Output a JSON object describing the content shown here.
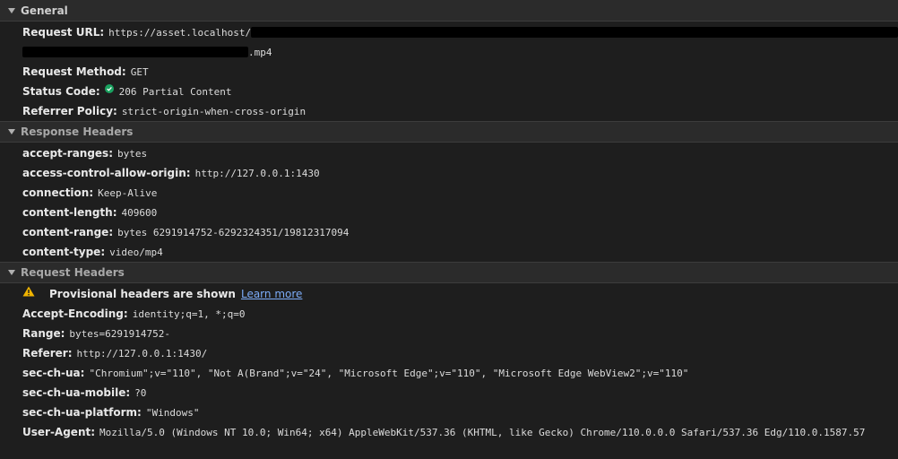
{
  "general": {
    "title": "General",
    "request_url_label": "Request URL:",
    "request_url_value": "https://asset.localhost/",
    "request_url_suffix": ".mp4",
    "request_method_label": "Request Method:",
    "request_method_value": "GET",
    "status_code_label": "Status Code:",
    "status_code_value": "206 Partial Content",
    "referrer_policy_label": "Referrer Policy:",
    "referrer_policy_value": "strict-origin-when-cross-origin"
  },
  "response_headers": {
    "title": "Response Headers",
    "items": [
      {
        "key": "accept-ranges:",
        "value": "bytes"
      },
      {
        "key": "access-control-allow-origin:",
        "value": "http://127.0.0.1:1430"
      },
      {
        "key": "connection:",
        "value": "Keep-Alive"
      },
      {
        "key": "content-length:",
        "value": "409600"
      },
      {
        "key": "content-range:",
        "value": "bytes 6291914752-6292324351/19812317094"
      },
      {
        "key": "content-type:",
        "value": "video/mp4"
      }
    ]
  },
  "request_headers": {
    "title": "Request Headers",
    "warning_text": "Provisional headers are shown",
    "learn_more": "Learn more",
    "items": [
      {
        "key": "Accept-Encoding:",
        "value": "identity;q=1, *;q=0"
      },
      {
        "key": "Range:",
        "value": "bytes=6291914752-"
      },
      {
        "key": "Referer:",
        "value": "http://127.0.0.1:1430/"
      },
      {
        "key": "sec-ch-ua:",
        "value": "\"Chromium\";v=\"110\", \"Not A(Brand\";v=\"24\", \"Microsoft Edge\";v=\"110\", \"Microsoft Edge WebView2\";v=\"110\""
      },
      {
        "key": "sec-ch-ua-mobile:",
        "value": "?0"
      },
      {
        "key": "sec-ch-ua-platform:",
        "value": "\"Windows\""
      },
      {
        "key": "User-Agent:",
        "value": "Mozilla/5.0 (Windows NT 10.0; Win64; x64) AppleWebKit/537.36 (KHTML, like Gecko) Chrome/110.0.0.0 Safari/537.36 Edg/110.0.1587.57"
      }
    ]
  },
  "colors": {
    "background": "#1e1e1e",
    "status_ok": "#1aa260",
    "warning": "#f0b400",
    "link": "#7cacf8"
  }
}
